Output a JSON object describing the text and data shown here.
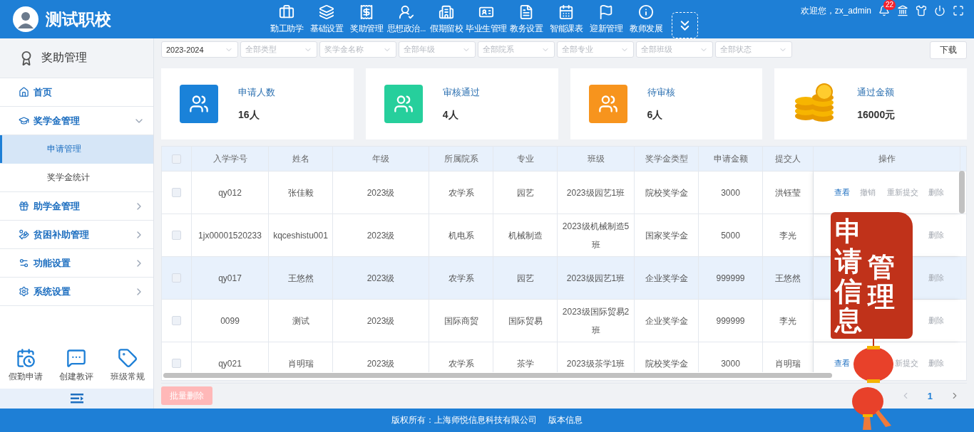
{
  "header": {
    "school_name": "测试职校",
    "nav": [
      {
        "label": "勤工助学"
      },
      {
        "label": "基础设置"
      },
      {
        "label": "奖助管理"
      },
      {
        "label": "思想政治..."
      },
      {
        "label": "假期留校"
      },
      {
        "label": "毕业生管理"
      },
      {
        "label": "教务设置"
      },
      {
        "label": "智能课表"
      },
      {
        "label": "迎新管理"
      },
      {
        "label": "教师发展"
      }
    ],
    "greeting": "欢迎您，zx_admin",
    "notification_count": "22"
  },
  "sidebar": {
    "title": "奖助管理",
    "items": [
      {
        "label": "首页"
      },
      {
        "label": "奖学金管理",
        "expanded": true,
        "children": [
          {
            "label": "申请管理",
            "selected": true
          },
          {
            "label": "奖学金统计",
            "selected": false
          }
        ]
      },
      {
        "label": "助学金管理",
        "expanded": false
      },
      {
        "label": "贫困补助管理",
        "expanded": false
      },
      {
        "label": "功能设置",
        "expanded": false
      },
      {
        "label": "系统设置",
        "expanded": false
      }
    ],
    "quick_links": [
      {
        "label": "假勤申请"
      },
      {
        "label": "创建教评"
      },
      {
        "label": "班级常规"
      }
    ]
  },
  "filters": [
    {
      "value": "2023-2024"
    },
    {
      "placeholder": "全部类型"
    },
    {
      "placeholder": "奖学金名称"
    },
    {
      "placeholder": "全部年级"
    },
    {
      "placeholder": "全部院系"
    },
    {
      "placeholder": "全部专业"
    },
    {
      "placeholder": "全部班级"
    },
    {
      "placeholder": "全部状态"
    }
  ],
  "download_button": "下载",
  "stats": [
    {
      "label": "申请人数",
      "value": "16人",
      "kind": "people",
      "color": "#1a82d9"
    },
    {
      "label": "审核通过",
      "value": "4人",
      "kind": "people",
      "color": "#26cf9c"
    },
    {
      "label": "待审核",
      "value": "6人",
      "kind": "people",
      "color": "#f7941d"
    },
    {
      "label": "通过金额",
      "value": "16000元",
      "kind": "coins"
    }
  ],
  "table": {
    "header_checked": false,
    "columns": [
      "入学学号",
      "姓名",
      "年级",
      "所属院系",
      "专业",
      "班级",
      "奖学金类型",
      "申请金额",
      "提交人",
      "操作"
    ],
    "rows": [
      {
        "selected": false,
        "checked": false,
        "cells": [
          "qy012",
          "张佳毅",
          "2023级",
          "农学系",
          "园艺",
          "2023级园艺1班",
          "院校奖学金",
          "3000",
          "洪钰莹"
        ],
        "actions": [
          {
            "label": "查看",
            "kind": "view",
            "disabled": false
          },
          {
            "label": "撤销",
            "kind": "revoke",
            "disabled": true
          },
          {
            "label": "重新提交",
            "kind": "resubmit",
            "disabled": true
          },
          {
            "label": "删除",
            "kind": "delete",
            "disabled": true
          }
        ]
      },
      {
        "selected": false,
        "checked": false,
        "cells": [
          "1jx00001520233",
          "kqceshistu001",
          "2023级",
          "机电系",
          "机械制造",
          "2023级机械制造5班",
          "国家奖学金",
          "5000",
          "李光"
        ],
        "actions": [
          {
            "label": "删除",
            "kind": "delete",
            "disabled": true
          }
        ]
      },
      {
        "selected": true,
        "checked": false,
        "cells": [
          "qy017",
          "王悠然",
          "2023级",
          "农学系",
          "园艺",
          "2023级园艺1班",
          "企业奖学金",
          "999999",
          "王悠然"
        ],
        "actions": [
          {
            "label": "删除",
            "kind": "delete",
            "disabled": true
          }
        ]
      },
      {
        "selected": false,
        "checked": false,
        "cells": [
          "0099",
          "测试",
          "2023级",
          "国际商贸",
          "国际贸易",
          "2023级国际贸易2班",
          "企业奖学金",
          "999999",
          "李光"
        ],
        "actions": [
          {
            "label": "删除",
            "kind": "delete",
            "disabled": true
          }
        ]
      },
      {
        "selected": false,
        "checked": false,
        "cells": [
          "qy021",
          "肖明瑞",
          "2023级",
          "农学系",
          "茶学",
          "2023级茶学1班",
          "院校奖学金",
          "3000",
          "肖明瑞"
        ],
        "actions": [
          {
            "label": "查看",
            "kind": "view",
            "disabled": false
          },
          {
            "label": "新提交",
            "kind": "resubmit",
            "disabled": true
          },
          {
            "label": "删除",
            "kind": "delete",
            "disabled": true
          }
        ]
      }
    ]
  },
  "batch_delete": {
    "label": "批量删除",
    "disabled": true
  },
  "pagination": {
    "page": "1"
  },
  "seal": {
    "columns": [
      "申请信息",
      "管理"
    ]
  },
  "footer": {
    "copyright": "版权所有：上海师悦信息科技有限公司",
    "version_link": "版本信息"
  }
}
